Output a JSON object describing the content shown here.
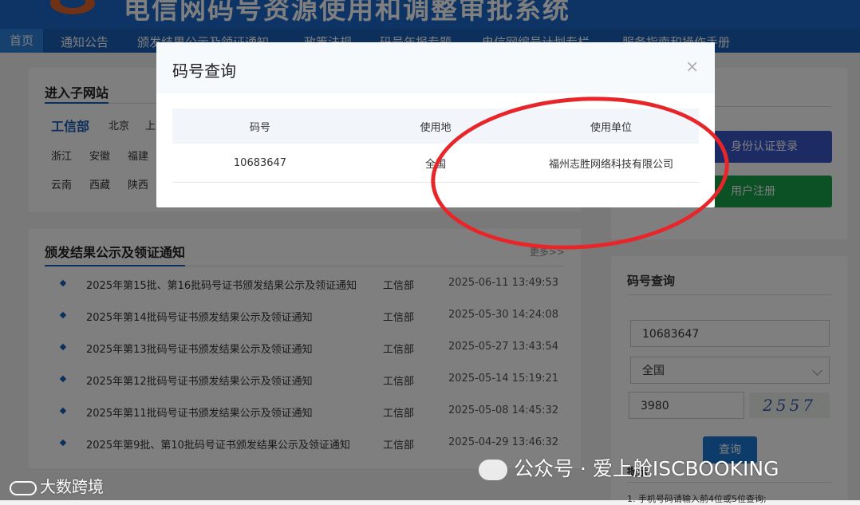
{
  "header": {
    "title": "电信网码号资源使用和调整审批系统",
    "nav": [
      "首页",
      "通知公告",
      "颁发结果公示及领证通知",
      "政策法规",
      "码号年报专题",
      "电信网编号计划专栏",
      "服务指南和操作手册"
    ]
  },
  "subsites": {
    "title": "进入子网站",
    "ministry": "工信部",
    "provinces_row1": [
      "北京",
      "上"
    ],
    "provinces_row2": [
      "浙江",
      "安徽",
      "福建"
    ],
    "provinces_row3": [
      "云南",
      "西藏",
      "陕西"
    ]
  },
  "login": {
    "cert_login": "身份认证登录",
    "user_register": "用户注册"
  },
  "news": {
    "title": "颁发结果公示及领证通知",
    "more": "更多>>",
    "items": [
      {
        "title": "2025年第15批、第16批码号证书颁发结果公示及领证通知",
        "org": "工信部",
        "date": "2025-06-11 13:49:53"
      },
      {
        "title": "2025年第14批码号证书颁发结果公示及领证通知",
        "org": "工信部",
        "date": "2025-05-30 14:24:08"
      },
      {
        "title": "2025年第13批码号证书颁发结果公示及领证通知",
        "org": "工信部",
        "date": "2025-05-27 13:43:54"
      },
      {
        "title": "2025年第12批码号证书颁发结果公示及领证通知",
        "org": "工信部",
        "date": "2025-05-14 15:19:21"
      },
      {
        "title": "2025年第11批码号证书颁发结果公示及领证通知",
        "org": "工信部",
        "date": "2025-05-08 14:45:32"
      },
      {
        "title": "2025年第9批、第10批码号证书颁发结果公示及领证通知",
        "org": "工信部",
        "date": "2025-04-29 13:46:32"
      }
    ]
  },
  "query_panel": {
    "title": "码号查询",
    "number_value": "10683647",
    "region_value": "全国",
    "captcha_value": "3980",
    "captcha_image_text": "2557",
    "query_button": "查询",
    "tip_title": "提示",
    "tip_line": "1. 手机号码请输入前4位或5位查询;"
  },
  "modal": {
    "title": "码号查询",
    "close": "×",
    "columns": [
      "码号",
      "使用地",
      "使用单位"
    ],
    "row": {
      "number": "10683647",
      "location": "全国",
      "unit": "福州志胜网络科技有限公司"
    }
  },
  "watermarks": {
    "left": "大数跨境",
    "right": "公众号 · 爱上舱ISCBOOKING"
  },
  "colors": {
    "nav_blue": "#1b5fb8",
    "login_blue": "#3a57c9",
    "register_green": "#19a04b",
    "annotation_red": "#e8262a"
  }
}
